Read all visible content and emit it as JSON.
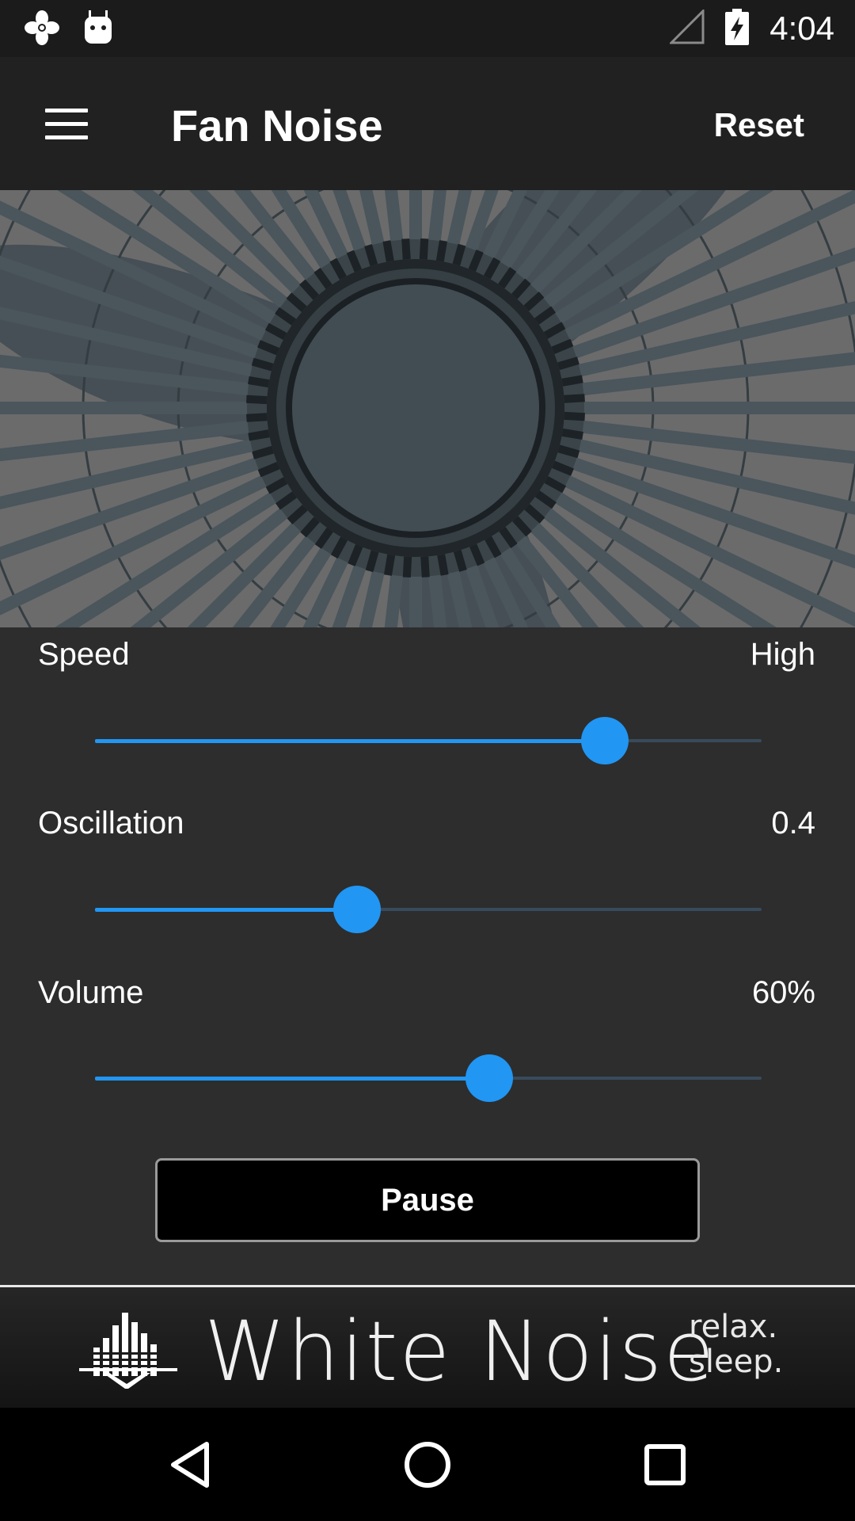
{
  "status_bar": {
    "time": "4:04",
    "left_icons": [
      "fan-notification-icon",
      "android-notification-icon"
    ],
    "right_icons": [
      "no-signal-icon",
      "battery-charging-icon"
    ]
  },
  "app_bar": {
    "menu_icon": "hamburger-menu-icon",
    "title": "Fan Noise",
    "reset_label": "Reset"
  },
  "controls": {
    "speed": {
      "label": "Speed",
      "value": "High",
      "position": 0.765
    },
    "oscillation": {
      "label": "Oscillation",
      "value": "0.4",
      "position": 0.393
    },
    "volume": {
      "label": "Volume",
      "value": "60%",
      "position": 0.592
    }
  },
  "pause_label": "Pause",
  "banner": {
    "title": "White Noise",
    "tagline_1": "relax.",
    "tagline_2": "sleep."
  },
  "nav_bar": {
    "back_icon": "back-triangle-icon",
    "home_icon": "home-circle-icon",
    "recents_icon": "recents-square-icon"
  },
  "colors": {
    "accent": "#2196f3",
    "background": "#2d2d2d",
    "app_bar": "#212121"
  }
}
